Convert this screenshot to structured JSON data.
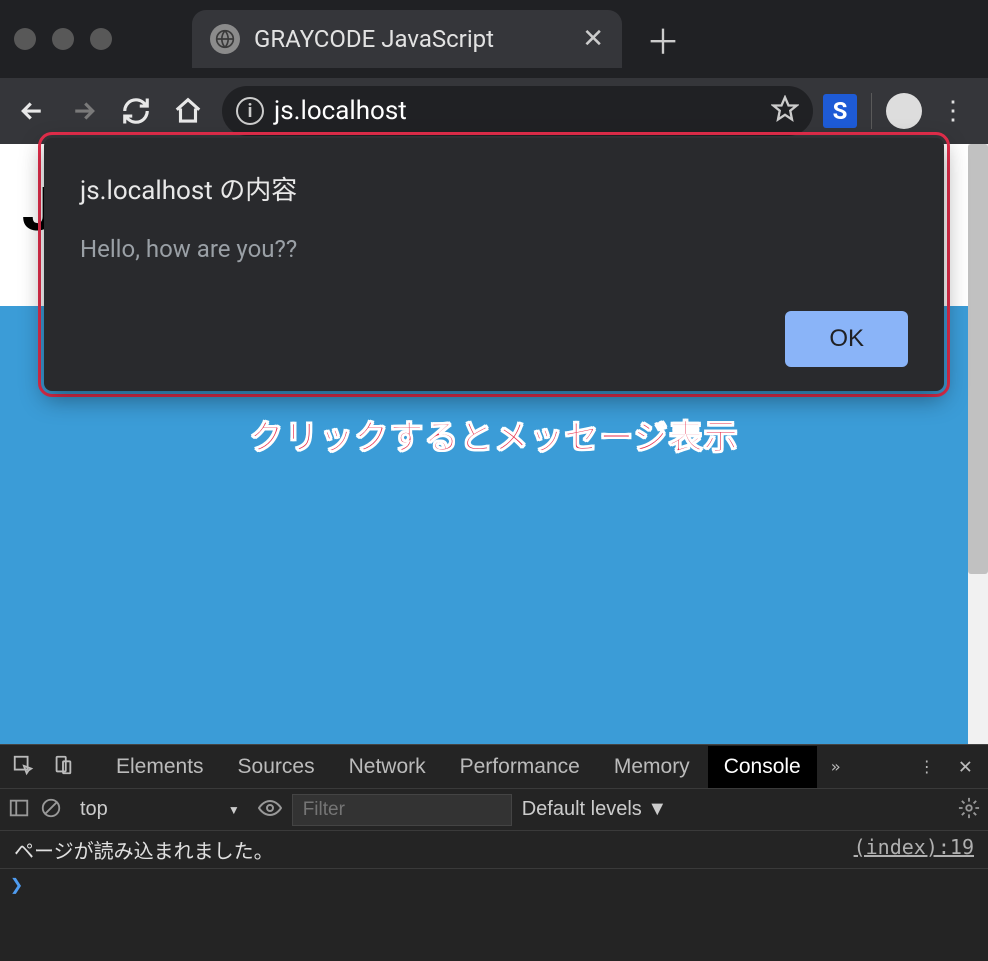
{
  "window": {
    "tab_title": "GRAYCODE JavaScript"
  },
  "toolbar": {
    "url": "js.localhost"
  },
  "alert": {
    "title": "js.localhost の内容",
    "message": "Hello, how are you??",
    "ok_label": "OK"
  },
  "page": {
    "heading_visible": "J",
    "annotation": "クリックするとメッセージ表示"
  },
  "devtools": {
    "tabs": {
      "elements": "Elements",
      "sources": "Sources",
      "network": "Network",
      "performance": "Performance",
      "memory": "Memory",
      "console": "Console"
    },
    "more": "»",
    "context": "top",
    "context_arrow": "▼",
    "filter_placeholder": "Filter",
    "levels": "Default levels ▼",
    "console_log": {
      "message": "ページが読み込まれました。",
      "source": "(index):19"
    },
    "prompt": "❯"
  }
}
